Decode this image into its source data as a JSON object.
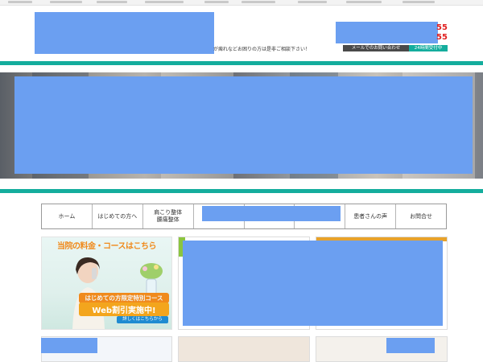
{
  "header": {
    "note": "が痺れなどお困りの方は是非ご相談下さい！",
    "phone_suffix_1": "55",
    "phone_suffix_2": "55",
    "mail_button": "メールでのお問い合わせ",
    "hours_badge": "24時間受付中"
  },
  "nav": {
    "items": [
      {
        "label": "ホーム"
      },
      {
        "label": "はじめての方へ"
      },
      {
        "label": "肩こり整体\n腰痛整体"
      },
      {
        "label": ""
      },
      {
        "label": ""
      },
      {
        "label": ""
      },
      {
        "label": "患者さんの声"
      },
      {
        "label": "お問合せ"
      }
    ]
  },
  "promo": {
    "title": "当院の料金・コースはこちら",
    "subtitle": "はじめての方限定特別コース",
    "web_offer": "Web割引実施中!",
    "link": "詳しくはこちらから"
  },
  "colors": {
    "teal": "#14ad9d",
    "redaction": "#6b9ff1",
    "phone_red": "#e02020",
    "promo_orange": "#f08a1c"
  }
}
